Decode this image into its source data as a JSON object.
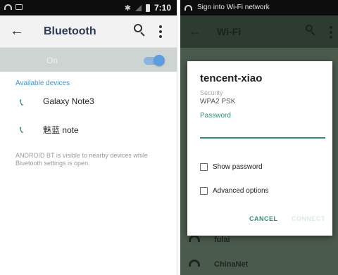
{
  "bluetooth_screen": {
    "status_bar": {
      "time": "7:10"
    },
    "title": "Bluetooth",
    "toggle_label": "On",
    "toggle_state": "on",
    "section_label": "Available devices",
    "devices": [
      {
        "name": "Galaxy Note3"
      },
      {
        "name": "魅蓝 note"
      }
    ],
    "visibility_note": "ANDROID BT is visible to nearby devices while Bluetooth settings is open."
  },
  "wifi_screen": {
    "status_bar": {
      "title": "Sign into Wi-Fi network"
    },
    "title": "Wi-Fi",
    "networks": [
      {
        "name": "fulai"
      },
      {
        "name": "ChinaNet"
      }
    ],
    "dialog": {
      "ssid": "tencent-xiao",
      "security_label": "Security",
      "security_value": "WPA2 PSK",
      "password_label": "Password",
      "password_value": "",
      "show_password_label": "Show password",
      "show_password_checked": false,
      "advanced_options_label": "Advanced options",
      "advanced_options_checked": false,
      "cancel_label": "CANCEL",
      "connect_label": "CONNECT"
    }
  },
  "colors": {
    "accent": "#2f8f6a",
    "toggle": "#5c9ce0",
    "section_label": "#3f92cf"
  }
}
